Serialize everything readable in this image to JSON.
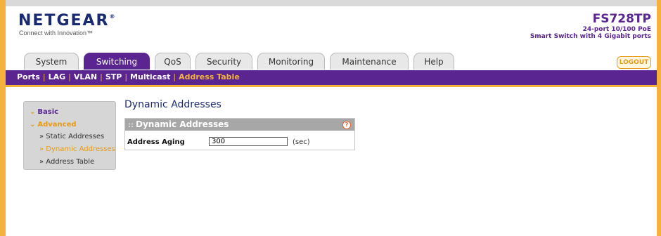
{
  "brand": {
    "name": "NETGEAR",
    "mark": "®",
    "tagline": "Connect with Innovation™"
  },
  "device": {
    "model": "FS728TP",
    "line1": "24-port 10/100 PoE",
    "line2": "Smart Switch with 4 Gigabit ports"
  },
  "tabs": [
    {
      "label": "System"
    },
    {
      "label": "Switching"
    },
    {
      "label": "QoS"
    },
    {
      "label": "Security"
    },
    {
      "label": "Monitoring"
    },
    {
      "label": "Maintenance"
    },
    {
      "label": "Help"
    }
  ],
  "logout_label": "LOGOUT",
  "subnav": [
    "Ports",
    "LAG",
    "VLAN",
    "STP",
    "Multicast",
    "Address Table"
  ],
  "leftnav": {
    "basic": "Basic",
    "advanced": "Advanced",
    "items": [
      "Static Addresses",
      "Dynamic Addresses",
      "Address Table"
    ]
  },
  "page": {
    "title": "Dynamic Addresses",
    "panel_title": "Dynamic Addresses",
    "help": "?",
    "aging_label": "Address Aging",
    "aging_value": "300",
    "aging_unit": "(sec)"
  },
  "colors": {
    "purple": "#5a2590",
    "orange": "#f4b23c",
    "navy": "#1a2a72"
  }
}
